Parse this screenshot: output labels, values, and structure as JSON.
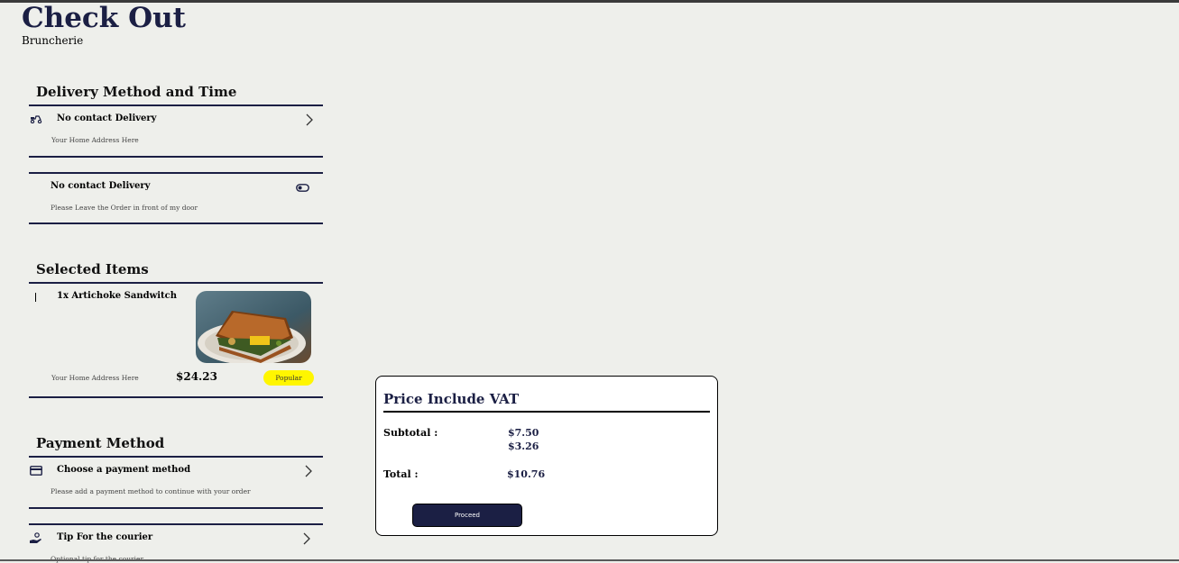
{
  "header": {
    "title": "Check Out",
    "restaurant": "Bruncherie"
  },
  "delivery": {
    "section_title": "Delivery Method and Time",
    "method": {
      "title": "No contact Delivery",
      "subtitle": "Your Home Address Here",
      "icon": "scooter-icon"
    },
    "option": {
      "title": "No contact Delivery",
      "subtitle": "Please Leave the Order in front of my door",
      "icon": "toggle-icon",
      "toggle_on": false
    }
  },
  "items": {
    "section_title": "Selected Items",
    "list": [
      {
        "name": "1x Artichoke Sandwitch",
        "address": "Your Home Address Here",
        "price": "$24.23",
        "badge": "Popular",
        "image": "sandwich-photo"
      }
    ]
  },
  "payment": {
    "section_title": "Payment Method",
    "method": {
      "title": "Choose a payment method",
      "subtitle": "Please add a payment method to continue with your order",
      "icon": "credit-card-icon"
    },
    "tip": {
      "title": "Tip For the courier",
      "subtitle": "Optional tip for the courier",
      "icon": "hand-coin-icon"
    }
  },
  "summary": {
    "title": "Price Include VAT",
    "subtotal_label": "Subtotal :",
    "subtotal_value": "$7.50",
    "extra_value": "$3.26",
    "total_label": "Total :",
    "total_value": "$10.76",
    "proceed_label": "Proceed"
  },
  "colors": {
    "navy": "#1b1f44",
    "background": "#eeefeb",
    "badge": "#fff600"
  }
}
